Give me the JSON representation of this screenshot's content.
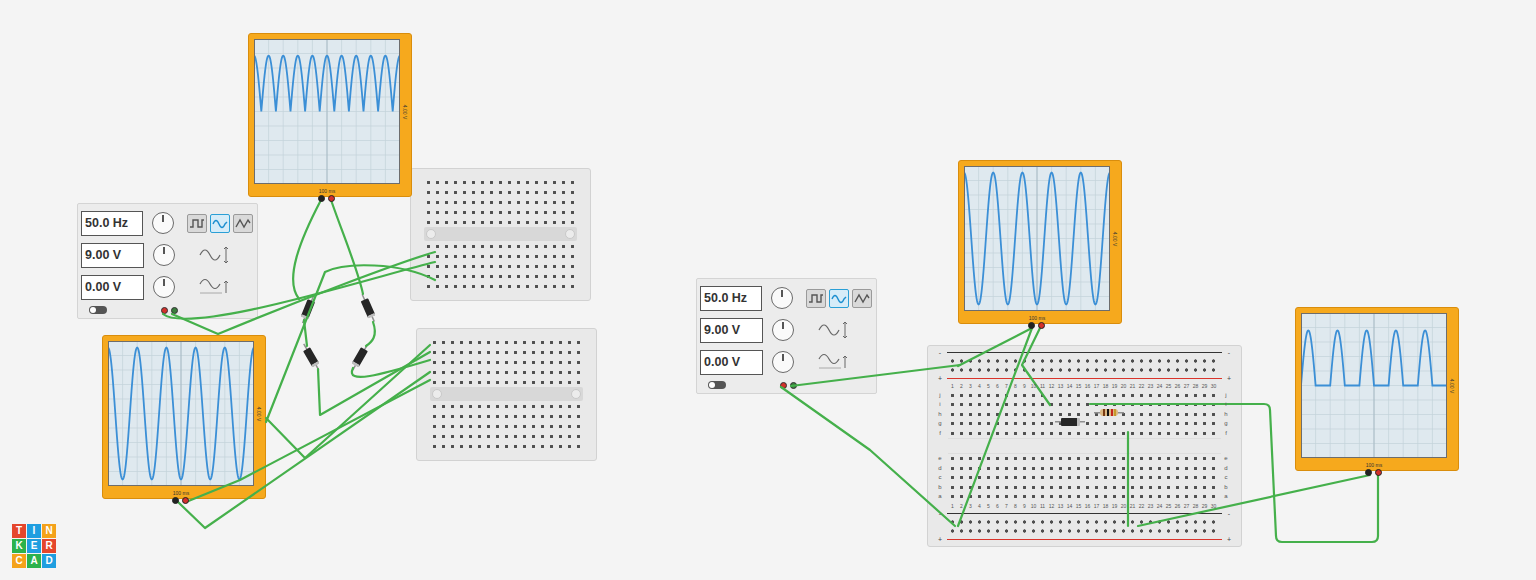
{
  "logo": {
    "letters": [
      "T",
      "I",
      "N",
      "K",
      "E",
      "R",
      "C",
      "A",
      "D"
    ]
  },
  "function_generators": [
    {
      "settings": [
        {
          "kind": "frequency",
          "value": "50.0 Hz"
        },
        {
          "kind": "amplitude",
          "value": "9.00 V"
        },
        {
          "kind": "offset",
          "value": "0.00 V"
        }
      ],
      "waveforms": [
        {
          "kind": "square",
          "selected": false
        },
        {
          "kind": "sine",
          "selected": true
        },
        {
          "kind": "triangle",
          "selected": false
        }
      ],
      "power_on": false
    },
    {
      "settings": [
        {
          "kind": "frequency",
          "value": "50.0 Hz"
        },
        {
          "kind": "amplitude",
          "value": "9.00 V"
        },
        {
          "kind": "offset",
          "value": "0.00 V"
        }
      ],
      "waveforms": [
        {
          "kind": "square",
          "selected": false
        },
        {
          "kind": "sine",
          "selected": true
        },
        {
          "kind": "triangle",
          "selected": false
        }
      ],
      "power_on": false
    }
  ],
  "oscilloscopes": [
    {
      "time_per_div": "100 ms",
      "volts_per_div": "4.00 V",
      "trace": {
        "kind": "full-wave",
        "cycles": 10,
        "level": 0.77
      }
    },
    {
      "time_per_div": "100 ms",
      "volts_per_div": "4.00 V",
      "trace": {
        "kind": "sine",
        "cycles": 5,
        "level": 0.91
      }
    },
    {
      "time_per_div": "100 ms",
      "volts_per_div": "4.00 V",
      "trace": {
        "kind": "sine",
        "cycles": 5,
        "level": 0.91
      }
    },
    {
      "time_per_div": "100 ms",
      "volts_per_div": "4.00 V",
      "trace": {
        "kind": "half-wave",
        "cycles": 5,
        "level": 0.76
      }
    }
  ],
  "breadboards": [
    {
      "kind": "small"
    },
    {
      "kind": "small"
    },
    {
      "kind": "full",
      "columns": [
        "1",
        "2",
        "3",
        "4",
        "5",
        "6",
        "7",
        "8",
        "9",
        "10",
        "11",
        "12",
        "13",
        "14",
        "15",
        "16",
        "17",
        "18",
        "19",
        "20",
        "21",
        "22",
        "23",
        "24",
        "25",
        "26",
        "27",
        "28",
        "29",
        "30"
      ],
      "rows": [
        "j",
        "i",
        "h",
        "g",
        "f",
        "e",
        "d",
        "c",
        "b",
        "a"
      ],
      "rail_signs": [
        "-",
        "+"
      ]
    }
  ],
  "parts": [
    {
      "kind": "diode"
    },
    {
      "kind": "diode"
    },
    {
      "kind": "diode"
    },
    {
      "kind": "diode"
    },
    {
      "kind": "diode"
    },
    {
      "kind": "resistor"
    }
  ]
}
